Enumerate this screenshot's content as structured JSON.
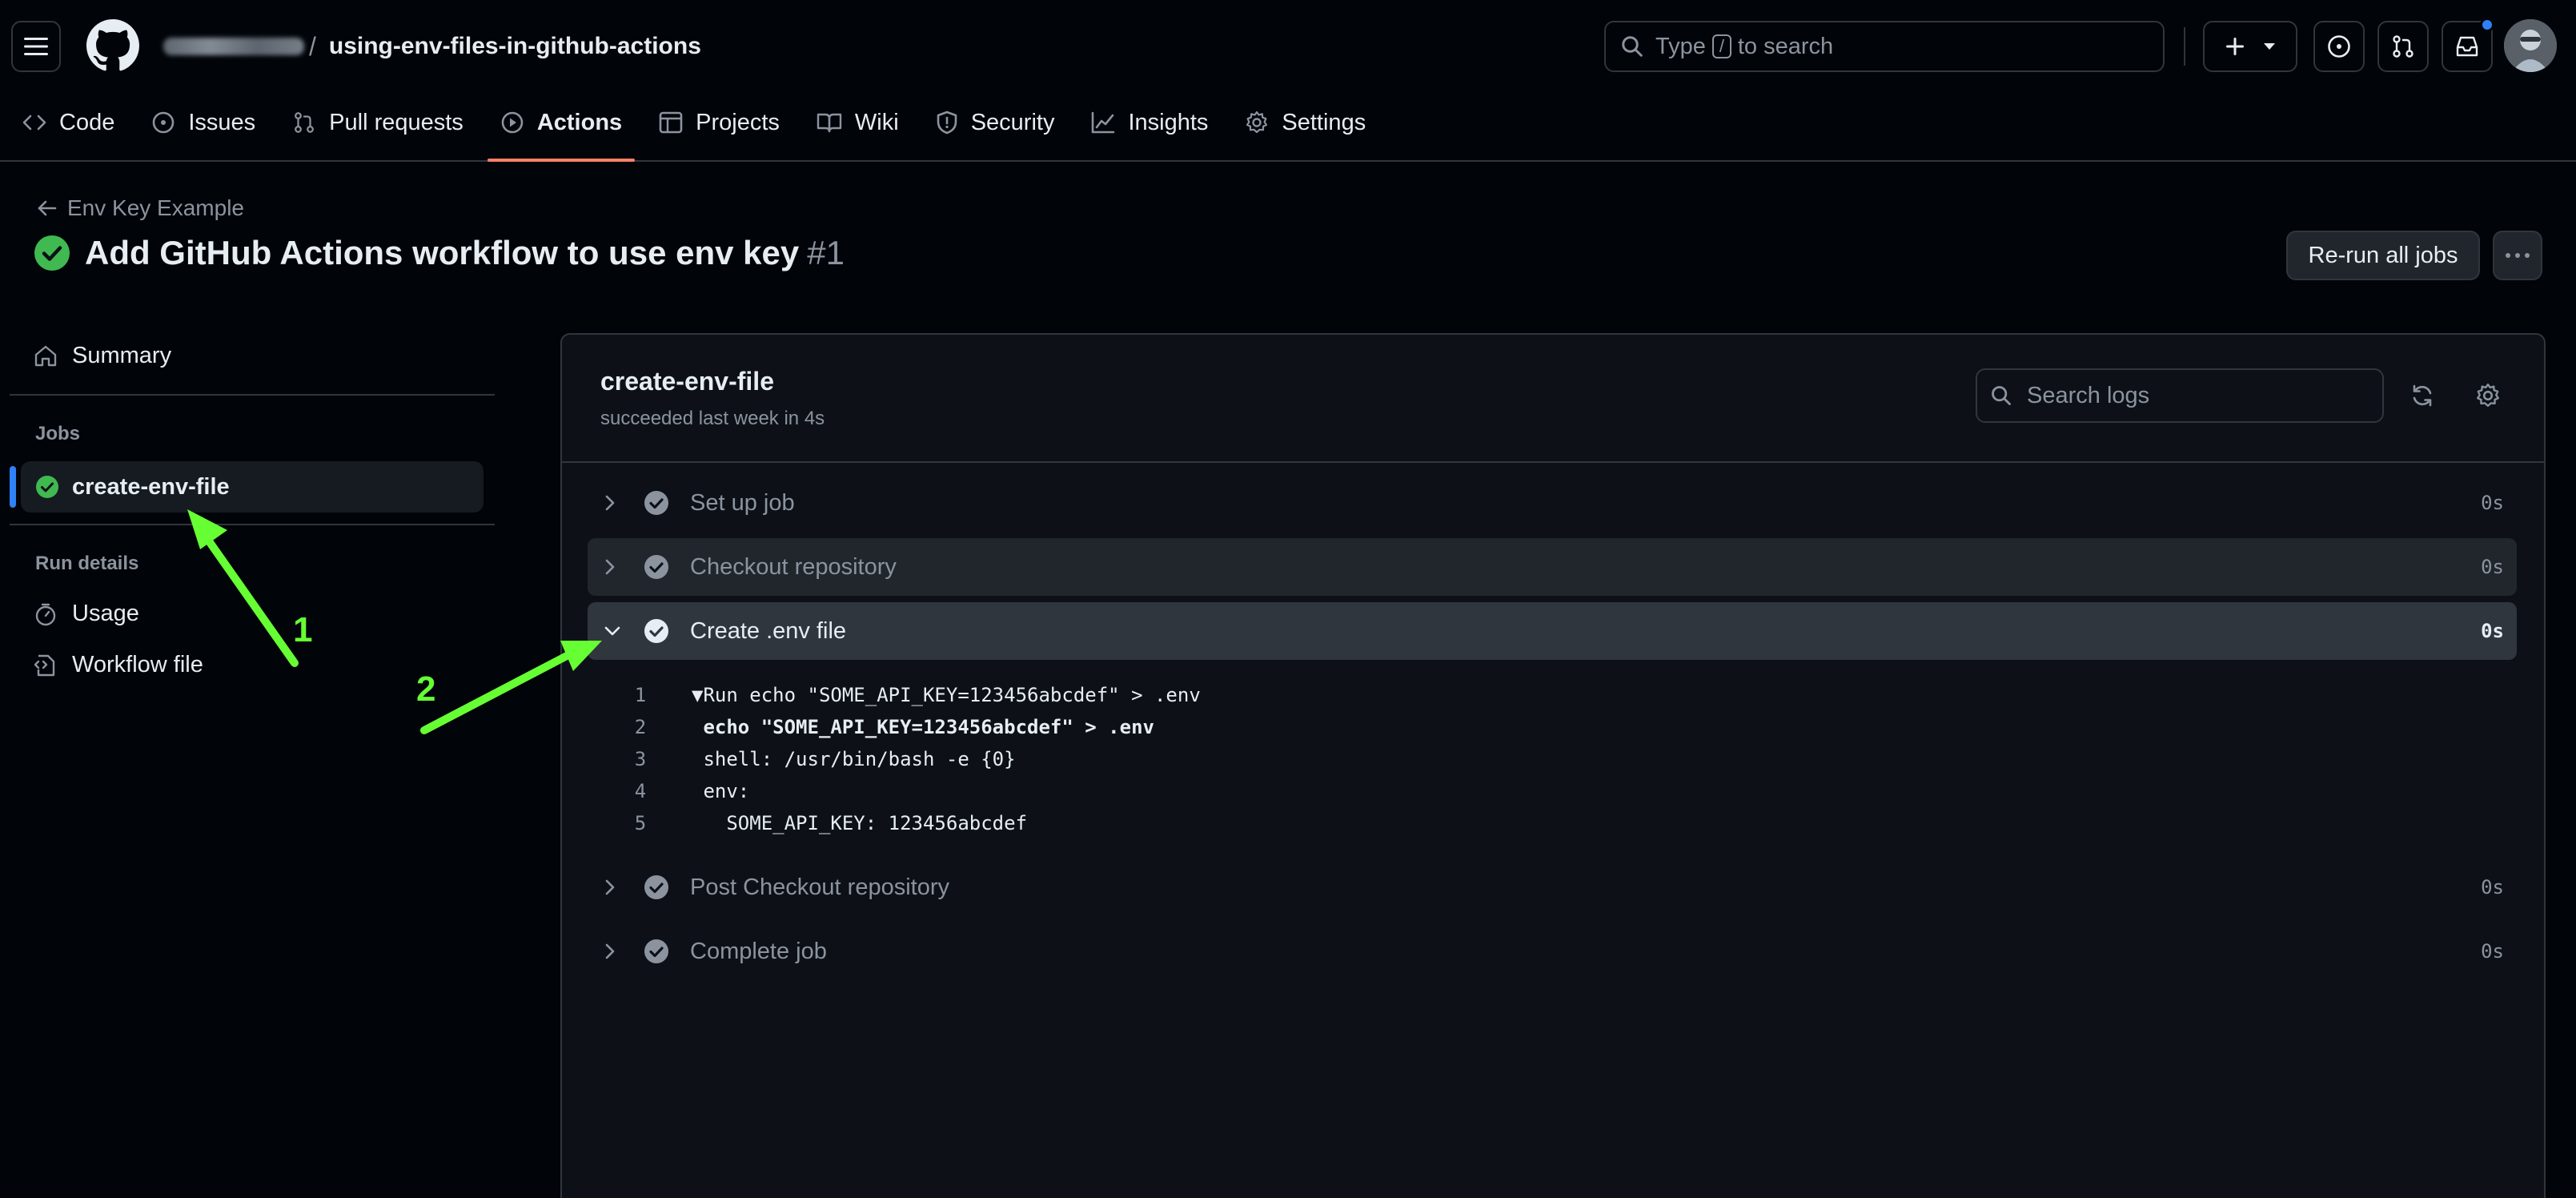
{
  "header": {
    "owner_blurred": "",
    "separator": "/",
    "repo": "using-env-files-in-github-actions",
    "search": {
      "pre": "Type",
      "key": "/",
      "post": "to search"
    },
    "colors": {
      "notification_dot": "#2f81f7"
    }
  },
  "nav": {
    "items": [
      {
        "label": "Code",
        "icon": "code-icon"
      },
      {
        "label": "Issues",
        "icon": "issue-icon"
      },
      {
        "label": "Pull requests",
        "icon": "pull-request-icon"
      },
      {
        "label": "Actions",
        "icon": "play-icon",
        "active": true
      },
      {
        "label": "Projects",
        "icon": "table-icon"
      },
      {
        "label": "Wiki",
        "icon": "book-icon"
      },
      {
        "label": "Security",
        "icon": "shield-icon"
      },
      {
        "label": "Insights",
        "icon": "graph-icon"
      },
      {
        "label": "Settings",
        "icon": "gear-icon"
      }
    ]
  },
  "run": {
    "back_label": "Env Key Example",
    "title": "Add GitHub Actions workflow to use env key",
    "number": "#1",
    "rerun_label": "Re-run all jobs",
    "status_color": "#3fb950"
  },
  "sidebar": {
    "summary": "Summary",
    "jobs_heading": "Jobs",
    "job": "create-env-file",
    "run_details_heading": "Run details",
    "usage": "Usage",
    "workflow_file": "Workflow file"
  },
  "job": {
    "title": "create-env-file",
    "subtitle": "succeeded last week in 4s",
    "search_placeholder": "Search logs",
    "steps": [
      {
        "label": "Set up job",
        "duration": "0s"
      },
      {
        "label": "Checkout repository",
        "duration": "0s"
      },
      {
        "label": "Create .env file",
        "duration": "0s",
        "expanded": true
      },
      {
        "label": "Post Checkout repository",
        "duration": "0s"
      },
      {
        "label": "Complete job",
        "duration": "0s"
      }
    ],
    "log_lines": [
      {
        "num": "1",
        "text": "▼Run echo \"SOME_API_KEY=123456abcdef\" > .env"
      },
      {
        "num": "2",
        "text": " echo \"SOME_API_KEY=123456abcdef\" > .env"
      },
      {
        "num": "3",
        "text": " shell: /usr/bin/bash -e {0}"
      },
      {
        "num": "4",
        "text": " env:"
      },
      {
        "num": "5",
        "text": "   SOME_API_KEY: 123456abcdef"
      }
    ]
  },
  "annotations": {
    "one": "1",
    "two": "2",
    "color": "#66ff33"
  }
}
